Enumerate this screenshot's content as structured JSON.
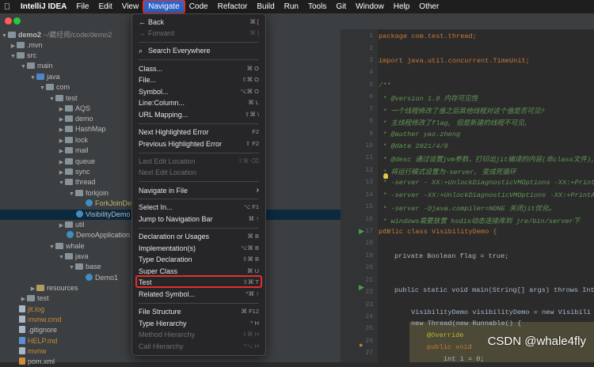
{
  "menubar": {
    "apple_icon": "apple-icon",
    "app_name": "IntelliJ IDEA",
    "items": [
      "File",
      "Edit",
      "View",
      "Navigate",
      "Code",
      "Refactor",
      "Build",
      "Run",
      "Tools",
      "Git",
      "Window",
      "Help",
      "Other"
    ],
    "active": "Navigate"
  },
  "colors": {
    "accent": "#2f65ca",
    "highlight_border": "#e0302a"
  },
  "tree": {
    "root_name": "demo2",
    "root_path": "~/藏经阁/code/demo2",
    "rows": [
      {
        "label": "demo2",
        "suffix": "~/藏经阁/code/demo2"
      },
      {
        "label": ".mvn"
      },
      {
        "label": "src"
      },
      {
        "label": "main"
      },
      {
        "label": "java"
      },
      {
        "label": "com"
      },
      {
        "label": "test"
      },
      {
        "label": "AQS"
      },
      {
        "label": "demo"
      },
      {
        "label": "HashMap"
      },
      {
        "label": "lock"
      },
      {
        "label": "mail"
      },
      {
        "label": "queue"
      },
      {
        "label": "sync"
      },
      {
        "label": "thread"
      },
      {
        "label": "forkjoin"
      },
      {
        "label": "ForkJoinDe"
      },
      {
        "label": "VisibilityDemo"
      },
      {
        "label": "util"
      },
      {
        "label": "DemoApplication"
      },
      {
        "label": "whale"
      },
      {
        "label": "java"
      },
      {
        "label": "base"
      },
      {
        "label": "Demo1"
      },
      {
        "label": "resources"
      },
      {
        "label": "test"
      },
      {
        "label": "jit.log"
      },
      {
        "label": "mvnw.cmd"
      },
      {
        "label": ".gitignore"
      },
      {
        "label": "HELP.md"
      },
      {
        "label": "mvnw"
      },
      {
        "label": "pom.xml"
      }
    ]
  },
  "editor": {
    "line_numbers": [
      "1",
      "2",
      "3",
      "4",
      "5",
      "6",
      "7",
      "8",
      "9",
      "10",
      "11",
      "12",
      "13",
      "14",
      "15",
      "16",
      "17",
      "18",
      "19",
      "20",
      "21",
      "22",
      "23",
      "24",
      "25",
      "26",
      "27"
    ],
    "lines": [
      "package com.test.thread;",
      "import java.util.concurrent.TimeUnit;",
      "/**",
      " * @version 1.0 内存可见性",
      " * 一个线程修改了值之后其他线程对这个值是否可见?",
      " * 主线程修改了flag, 但是新建的线程不可见,",
      " * @auther yao.zheng",
      " * @date 2021/4/8",
      " * @desc 通过设置jvm参数，打印出jit编译的内容(非class文件),",
      " * 将运行模式设置为-server, 变成死循环",
      " * -server - XX:+UnlockDiagnosticVMOptions -XX:+PrintA",
      " * -server -XX:+UnlockDiagnosticVMOptions -XX:+PrintA",
      " * -server -Djava.compiler=NONE 关闭jit优化。",
      " * windows需要放置 hsdis动态连接库到 jre/bin/server下",
      " */",
      "public class VisibilityDemo {",
      "private Boolean flag = true;",
      "public static void main(String[] args) throws Int",
      "VisibilityDemo visibilityDemo = new Visibili",
      "new Thread(new Runnable() {",
      "@Override",
      "public void",
      "int i = 0;"
    ]
  },
  "menu": {
    "items": [
      {
        "label": "Back",
        "shortcut": "⌘ [",
        "disabled": false
      },
      {
        "label": "Forward",
        "shortcut": "⌘ ]",
        "disabled": true
      },
      {
        "label": "Search Everywhere",
        "shortcut": "",
        "disabled": false
      },
      {
        "label": "Class...",
        "shortcut": "⌘ O",
        "disabled": false
      },
      {
        "label": "File...",
        "shortcut": "⇧⌘ O",
        "disabled": false
      },
      {
        "label": "Symbol...",
        "shortcut": "⌥⌘ O",
        "disabled": false
      },
      {
        "label": "Line:Column...",
        "shortcut": "⌘ L",
        "disabled": false
      },
      {
        "label": "URL Mapping...",
        "shortcut": "⇧⌘ \\",
        "disabled": false
      },
      {
        "label": "Next Highlighted Error",
        "shortcut": "F2",
        "disabled": false
      },
      {
        "label": "Previous Highlighted Error",
        "shortcut": "⇧ F2",
        "disabled": false
      },
      {
        "label": "Last Edit Location",
        "shortcut": "⇧⌘ ⌫",
        "disabled": true
      },
      {
        "label": "Next Edit Location",
        "shortcut": "",
        "disabled": true
      },
      {
        "label": "Navigate in File",
        "shortcut": "",
        "disabled": false
      },
      {
        "label": "Select In...",
        "shortcut": "⌥ F1",
        "disabled": false
      },
      {
        "label": "Jump to Navigation Bar",
        "shortcut": "⌘ ↑",
        "disabled": false
      },
      {
        "label": "Declaration or Usages",
        "shortcut": "⌘ B",
        "disabled": false
      },
      {
        "label": "Implementation(s)",
        "shortcut": "⌥⌘ B",
        "disabled": false
      },
      {
        "label": "Type Declaration",
        "shortcut": "⇧⌘ B",
        "disabled": false
      },
      {
        "label": "Super Class",
        "shortcut": "⌘ U",
        "disabled": false
      },
      {
        "label": "Test",
        "shortcut": "⇧⌘ T",
        "disabled": false
      },
      {
        "label": "Related Symbol...",
        "shortcut": "^⌘ ↑",
        "disabled": false
      },
      {
        "label": "File Structure",
        "shortcut": "⌘ F12",
        "disabled": false
      },
      {
        "label": "Type Hierarchy",
        "shortcut": "^ H",
        "disabled": false
      },
      {
        "label": "Method Hierarchy",
        "shortcut": "⇧⌘ H",
        "disabled": true
      },
      {
        "label": "Call Hierarchy",
        "shortcut": "^⌥ H",
        "disabled": true
      }
    ],
    "submenu_arrow_icon": "chevron-right-icon"
  },
  "watermark": "CSDN @whale4fly"
}
